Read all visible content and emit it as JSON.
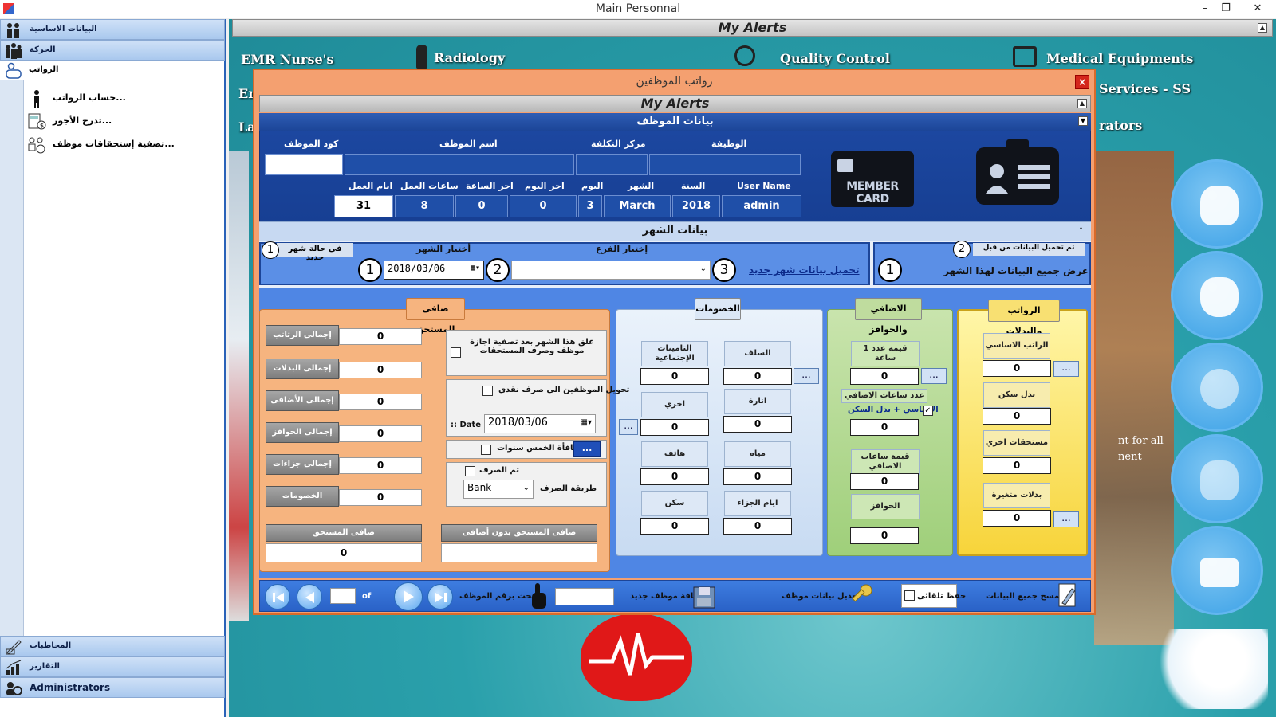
{
  "window": {
    "title": "Main Personnal"
  },
  "sidebar": {
    "top_headers": [
      {
        "label": "البيانات الاساسية",
        "icon": "people-icon"
      },
      {
        "label": "الحركة",
        "icon": "group-icon"
      }
    ],
    "open_header": {
      "label": "الرواتب",
      "icon": "money-person-icon"
    },
    "sub_items": [
      {
        "label": "حساب الرواتب...",
        "icon": "person-icon"
      },
      {
        "label": "تدرج الأجور...",
        "icon": "calculator-icon"
      },
      {
        "label": "تصفية إستحقاقات موظف...",
        "icon": "team-settings-icon"
      }
    ],
    "bottom_headers": [
      {
        "label": "المخاطبات",
        "icon": "letter-icon"
      },
      {
        "label": "التقارير",
        "icon": "report-chart-icon"
      },
      {
        "label": "Administrators",
        "icon": "admin-icon"
      }
    ]
  },
  "background": {
    "alerts_title": "My Alerts",
    "tiles": [
      "EMR Nurse's",
      "Radiology",
      "Quality Control",
      "Medical Equipments",
      "Services - SS",
      "rators",
      "Em",
      "La"
    ],
    "side_text": [
      "nt for all",
      "nent"
    ]
  },
  "modal": {
    "title": "رواتب الموظفين",
    "alerts_title": "My Alerts",
    "employee_section": {
      "header": "بيانات الموظف",
      "labels": {
        "code": "كود الموظف",
        "name": "اسم الموظف",
        "cost_center": "مركز التكلفة",
        "job": "الوظيفة",
        "work_days": "ايام العمل",
        "work_hours": "ساعات العمل",
        "hour_wage": "اجر الساعة",
        "day_wage": "اجر اليوم",
        "day": "اليوم",
        "month": "الشهر",
        "year": "السنة",
        "user_name": "User Name"
      },
      "values": {
        "code": "",
        "name": "",
        "cost_center": "",
        "job": "",
        "work_days": "31",
        "work_hours": "8",
        "hour_wage": "0",
        "day_wage": "0",
        "day": "3",
        "month": "March",
        "year": "2018",
        "user_name": "admin"
      },
      "member_card": "MEMBER CARD"
    },
    "month_section": {
      "header": "بيانات الشهر",
      "new_month_label": "في حالة شهر جديد",
      "choose_month_label": "أختيار الشهر",
      "month_date": "2018/03/06",
      "choose_branch_label": "إختيار الفرع",
      "branch_value": "",
      "load_new_month_link": "تحميل بيانات شهر جديد",
      "loaded_before_label": "تم تحميل البيانات من قبل",
      "show_all_label": "عرض جميع البيانات لهذا الشهر",
      "step_numbers": [
        "1",
        "2",
        "3",
        "1",
        "2",
        "1"
      ]
    },
    "salaries_card": {
      "header": "الرواتب والبدلات",
      "fields": [
        {
          "label": "الراتب الاساسي",
          "value": "0"
        },
        {
          "label": "بدل سكن",
          "value": "0"
        },
        {
          "label": "مستحقات اخري",
          "value": "0"
        },
        {
          "label": "بدلات متغيرة",
          "value": "0"
        }
      ],
      "dots": "..."
    },
    "overtime_card": {
      "header": "الاضافي والحوافز",
      "hour_value_label": "قيمة عدد 1 ساعة",
      "hour_value": "0",
      "overtime_hours_label": "عدد ساعات الاضافي",
      "basic_plus_housing_label": "الاساسي + بدل السكن",
      "overtime_hours": "0",
      "overtime_value_label": "قيمة ساعات الاضافي",
      "overtime_value": "0",
      "incentives_label": "الحوافز",
      "incentives": "0"
    },
    "deductions_card": {
      "header": "الخصومات",
      "fields": [
        {
          "label": "السلف",
          "value": "0"
        },
        {
          "label": "التامينات الإجتماعية",
          "value": "0"
        },
        {
          "label": "انارة",
          "value": "0"
        },
        {
          "label": "اخري",
          "value": "0"
        },
        {
          "label": "مياه",
          "value": "0"
        },
        {
          "label": "هاتف",
          "value": "0"
        },
        {
          "label": "ايام الجزاء",
          "value": "0"
        },
        {
          "label": "سكن",
          "value": "0"
        }
      ]
    },
    "net_card": {
      "header": "صافى المستحق",
      "close_month_label": "غلق هذا الشهر بعد تصفية اجازة موظف وصرف المستحقات",
      "cash_transfer_label": "تحويل الموظفين الي صرف نقدي",
      "date_label": ":: Date",
      "date_value": "2018/03/06",
      "five_years_label": "مكافأة الخمس سنوات",
      "paid_label": "تم الصرف",
      "payment_method_label": "طريقة الصرف",
      "payment_method": "Bank",
      "totals": [
        {
          "label": "إجمالى الرتاتب",
          "value": "0"
        },
        {
          "label": "إجمالى البدلات",
          "value": "0"
        },
        {
          "label": "إجمالى الأضافى",
          "value": "0"
        },
        {
          "label": "إجمالى الحوافز",
          "value": "0"
        },
        {
          "label": "إجمالى جزاءات",
          "value": "0"
        },
        {
          "label": "الخصومات",
          "value": "0"
        }
      ],
      "net_label": "صافى المستحق",
      "net_value": "0",
      "net_no_overtime_label": "صافى المستحق بدون أضافى",
      "net_no_overtime_value": ""
    },
    "bottom_bar": {
      "record_number": "",
      "of_label": "of",
      "search_label": "بحث برقم الموظف",
      "search_value": "",
      "add_employee_label": "اضافة موظف جديد",
      "edit_employee_label": "تعديل بيانات موظف",
      "auto_save_label": "حفظ تلقائى",
      "delete_all_label": "مسح جميع البيانات"
    }
  }
}
